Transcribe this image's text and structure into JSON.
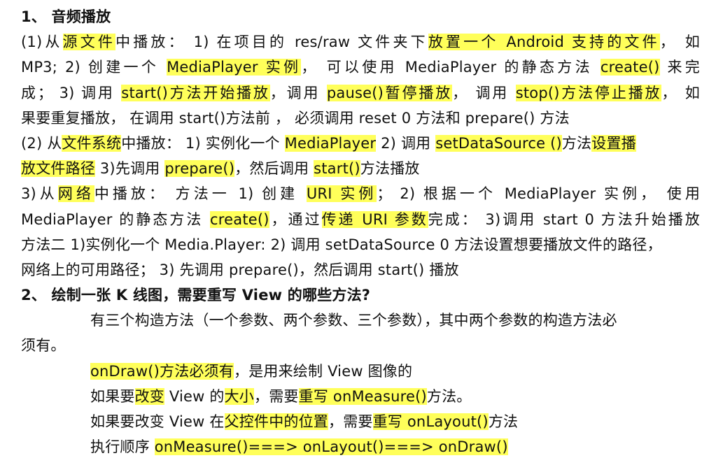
{
  "heading1": "1、  音频播放",
  "lines_s1": [
    [
      [
        "t",
        "(1)从"
      ],
      [
        "h",
        "源文件"
      ],
      [
        "t",
        "中播放：  1) 在项目的 res/raw 文件夹下"
      ],
      [
        "h",
        "放置一个 Android 支持的文件"
      ],
      [
        "t",
        "，  如"
      ]
    ],
    [
      [
        "t",
        "MP3; 2) 创建一个 "
      ],
      [
        "h",
        "MediaPlayer 实例"
      ],
      [
        "t",
        "，  可以使用 MediaPlayer 的静态方法 "
      ],
      [
        "h",
        "create()"
      ],
      [
        "t",
        " 来完"
      ]
    ],
    [
      [
        "t",
        "成；  3) 调用 "
      ],
      [
        "h",
        "start()方法开始播放"
      ],
      [
        "t",
        "，调用 "
      ],
      [
        "h",
        "pause()暂停播放"
      ],
      [
        "t",
        "，  调用 "
      ],
      [
        "h",
        "stop()方法停止播放"
      ],
      [
        "t",
        "，  如"
      ]
    ],
    [
      [
        "t",
        "果要重复播放，  在调用 start()方法前 ，  必须调用 reset 0 方法和 prepare() 方法"
      ]
    ],
    [
      [
        "t",
        "(2) 从"
      ],
      [
        "h",
        "文件系统"
      ],
      [
        "t",
        "中播放：  1) 实例化一个 "
      ],
      [
        "h",
        "MediaPlayer"
      ],
      [
        "t",
        " 2) 调用 "
      ],
      [
        "h",
        "setDataSource ()"
      ],
      [
        "t",
        "方法"
      ],
      [
        "h",
        "设置播"
      ]
    ],
    [
      [
        "h",
        "放文件路径"
      ],
      [
        "t",
        " 3)先调用 "
      ],
      [
        "h",
        "prepare()"
      ],
      [
        "t",
        "，然后调用 "
      ],
      [
        "h",
        "start()"
      ],
      [
        "t",
        "方法播放"
      ]
    ],
    [
      [
        "t",
        "3)从"
      ],
      [
        "h",
        "网络"
      ],
      [
        "t",
        "中播放：  方法一 1) 创建 "
      ],
      [
        "h",
        "URI 实例"
      ],
      [
        "t",
        "；  2) 根据一个 MediaPlayer 实例，  使用"
      ]
    ],
    [
      [
        "t",
        "MediaPlayer 的静态方法 "
      ],
      [
        "h",
        "create()"
      ],
      [
        "t",
        "，通过"
      ],
      [
        "h",
        "传递 URI 参数"
      ],
      [
        "t",
        "完成：  3)调用 start 0 方法升始播放"
      ]
    ],
    [
      [
        "t",
        "方法二 1)实例化一个 Media.Player: 2) 调用 setDataSource 0 方法设置想要播放文件的路径，"
      ]
    ],
    [
      [
        "t",
        "网络上的可用路径；  3) 先调用 prepare()，然后调用 start() 播放"
      ]
    ]
  ],
  "heading2": "2、  绘制一张 K 线图，需要重写 View 的哪些方法?",
  "lines_s2": [
    [
      [
        "t",
        "有三个构造方法（一个参数、两个参数、三个参数），其中两个参数的构造方法必"
      ]
    ],
    [
      [
        "t",
        "须有。"
      ]
    ],
    [
      [
        "h",
        "onDraw()方法必须有"
      ],
      [
        "t",
        "，是用来绘制 View 图像的"
      ]
    ],
    [
      [
        "t",
        "如果要"
      ],
      [
        "h",
        "改变"
      ],
      [
        "t",
        " View 的"
      ],
      [
        "h",
        "大小"
      ],
      [
        "t",
        "，需要"
      ],
      [
        "h",
        "重写 onMeasure()"
      ],
      [
        "t",
        "方法。"
      ]
    ],
    [
      [
        "t",
        "如果要改变 View 在"
      ],
      [
        "h",
        "父控件中的位置"
      ],
      [
        "t",
        "，需要"
      ],
      [
        "h",
        "重写 onLayout()"
      ],
      [
        "t",
        "方法"
      ]
    ],
    [
      [
        "t",
        "执行顺序 "
      ],
      [
        "h",
        "onMeasure()===> onLayout()===> onDraw()"
      ]
    ]
  ]
}
